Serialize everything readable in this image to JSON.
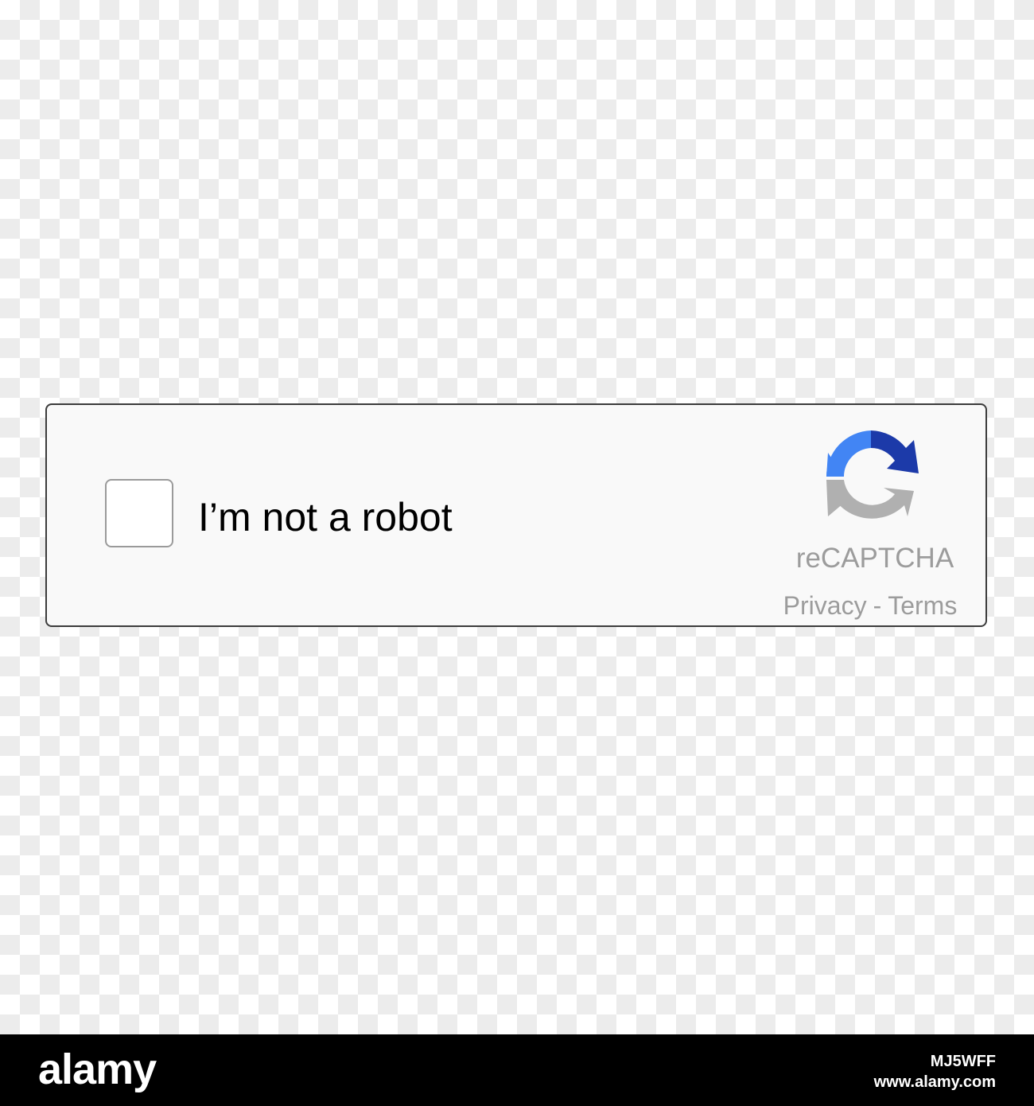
{
  "captcha": {
    "checkbox_label": "I’m not a robot",
    "checked": false,
    "brand": "reCAPTCHA",
    "privacy_link": "Privacy",
    "separator": "-",
    "terms_link": "Terms",
    "logo_icon": "recaptcha-arrows-icon",
    "colors": {
      "blue_light": "#4285f4",
      "blue_dark": "#1c3aa9",
      "grey": "#b0b0b0",
      "text_grey": "#9c9c9c"
    }
  },
  "watermark": {
    "wordmark": "alamy",
    "image_id": "MJ5WFF",
    "site": "www.alamy.com"
  }
}
